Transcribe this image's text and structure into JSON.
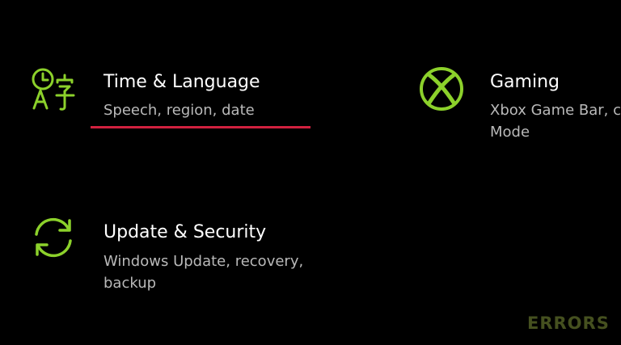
{
  "colors": {
    "background": "#000000",
    "icon_accent": "#8cd12b",
    "title_text": "#ffffff",
    "subtitle_text": "#b9b9b9",
    "hover_underline": "#d1213f",
    "watermark": "#45501f"
  },
  "tiles": [
    {
      "id": "time-language",
      "icon": "time-language-icon",
      "title": "Time & Language",
      "subtitle": "Speech, region, date"
    },
    {
      "id": "gaming",
      "icon": "xbox-icon",
      "title": "Gaming",
      "subtitle": "Xbox Game Bar, c Mode"
    },
    {
      "id": "update-security",
      "icon": "sync-icon",
      "title": "Update & Security",
      "subtitle": "Windows Update, recovery, backup"
    }
  ],
  "watermark": "ERRORS"
}
